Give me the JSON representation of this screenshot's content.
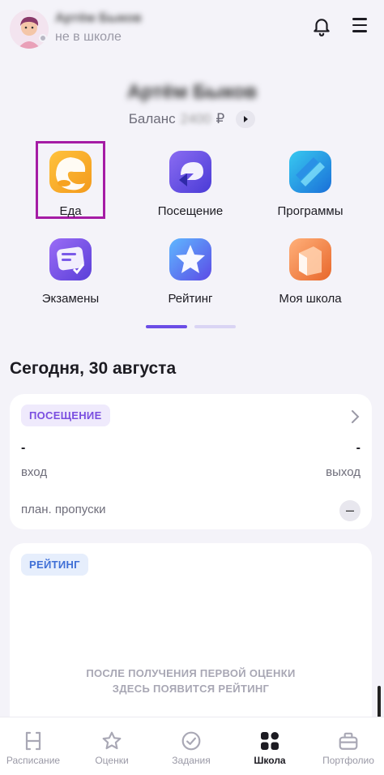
{
  "header": {
    "user_name": "Артём Быков",
    "user_status": "не в школе"
  },
  "profile": {
    "name": "Артём Быков",
    "balance_label": "Баланс",
    "balance_amount": "2400",
    "currency": "₽"
  },
  "tiles": [
    {
      "label": "Еда",
      "icon": "food-icon"
    },
    {
      "label": "Посещение",
      "icon": "attendance-icon"
    },
    {
      "label": "Программы",
      "icon": "programs-icon"
    },
    {
      "label": "Экзамены",
      "icon": "exams-icon"
    },
    {
      "label": "Рейтинг",
      "icon": "rating-icon"
    },
    {
      "label": "Моя школа",
      "icon": "school-icon"
    }
  ],
  "today": {
    "title": "Сегодня, 30 августа"
  },
  "attendance_card": {
    "pill": "ПОСЕЩЕНИЕ",
    "entry_value": "-",
    "exit_value": "-",
    "entry_label": "вход",
    "exit_label": "выход",
    "planned_absences_label": "план. пропуски",
    "planned_absences_value": "–"
  },
  "rating_card": {
    "pill": "РЕЙТИНГ",
    "empty_line1": "ПОСЛЕ ПОЛУЧЕНИЯ ПЕРВОЙ ОЦЕНКИ",
    "empty_line2": "ЗДЕСЬ ПОЯВИТСЯ РЕЙТИНГ"
  },
  "tabbar": {
    "tabs": [
      {
        "label": "Расписание",
        "icon": "schedule-icon",
        "active": false
      },
      {
        "label": "Оценки",
        "icon": "star-icon",
        "active": false
      },
      {
        "label": "Задания",
        "icon": "check-circle-icon",
        "active": false
      },
      {
        "label": "Школа",
        "icon": "grid-icon",
        "active": true
      },
      {
        "label": "Портфолио",
        "icon": "briefcase-icon",
        "active": false
      }
    ]
  },
  "colors": {
    "accent": "#6b4de6",
    "highlight_frame": "#a51ca5",
    "attendance_pill_bg": "#efeafc",
    "attendance_pill_text": "#7a4ee0",
    "rating_pill_bg": "#e6eefc",
    "rating_pill_text": "#3f6fd6"
  }
}
